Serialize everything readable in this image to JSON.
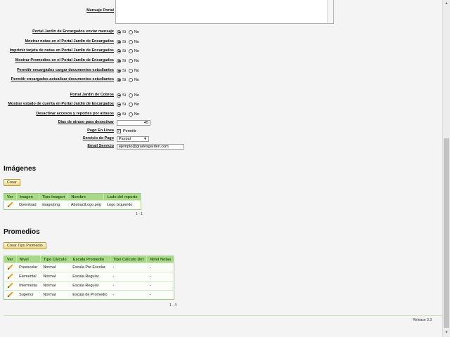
{
  "settings": {
    "message_label": "Mensaje Portal",
    "yes": "Si",
    "no": "No",
    "radio_rows": [
      {
        "label": "Portal Jardin de Encargados enviar mensaje",
        "value": "Si"
      },
      {
        "label": "Mostrar notas en el Portal Jardin de Encargados",
        "value": "Si"
      },
      {
        "label": "Imprimir tarjeta de notas en Portal Jardin de Encargados",
        "value": "Si"
      },
      {
        "label": "Mostrar Promedios en el Portal Jardin de Encargados",
        "value": "Si"
      },
      {
        "label": "Permitir encargados cargar documentos estudiantes",
        "value": "Si"
      },
      {
        "label": "Permitir encargados actualizar documentos estudiantes",
        "value": "Si"
      },
      {
        "label": "Portal Jardin de Cobros",
        "value": "Si"
      },
      {
        "label": "Mostrar estado de cuenta en Portal Jardin de Encargados",
        "value": "Si"
      },
      {
        "label": "Desactivar accesos y reportes por atrasos",
        "value": "Si"
      }
    ],
    "days_label": "Dias de atraso para desactivar",
    "days_value": "45",
    "online_pay_label": "Pago En Linea",
    "online_pay_option": "Permitir",
    "online_pay_checked": true,
    "pay_service_label": "Servicio de Pago",
    "pay_service_value": "Paypal",
    "email_service_label": "Email Servicio",
    "email_service_value": "ejemplo@gradesgarden.com"
  },
  "images": {
    "title": "Imágenes",
    "create_label": "Crear",
    "columns": [
      "Ver",
      "Imagen",
      "Tipo Imagen",
      "Nombre",
      "Lado del reporte"
    ],
    "rows": [
      {
        "image": "Download",
        "type": "image/png",
        "name": "AbstractLogo.png",
        "side": "Logo Izquierdo"
      }
    ],
    "pager": "1 - 1"
  },
  "averages": {
    "title": "Promedios",
    "create_label": "Crear Tipo Promedio",
    "columns": [
      "Ver",
      "Nivel",
      "Tipo Cálculo",
      "Escala Promedio",
      "Tipo Cálculo Det",
      "Nivel Notas"
    ],
    "rows": [
      {
        "level": "Preescolar",
        "calc": "Normal",
        "scale": "Escala Pre Escolar",
        "calc_det": "-",
        "notes_level": "-"
      },
      {
        "level": "Elemental",
        "calc": "Normal",
        "scale": "Escala Regular",
        "calc_det": "-",
        "notes_level": "-"
      },
      {
        "level": "Intermedia",
        "calc": "Normal",
        "scale": "Escala Regular",
        "calc_det": "-",
        "notes_level": "-"
      },
      {
        "level": "Superior",
        "calc": "Normal",
        "scale": "Escala de Promedio",
        "calc_det": "-",
        "notes_level": "-"
      }
    ],
    "pager": "1 - 4"
  },
  "footer": {
    "release": "Release 3.3"
  },
  "colors": {
    "grid_header": "#a9d889",
    "button": "#efd98a"
  }
}
